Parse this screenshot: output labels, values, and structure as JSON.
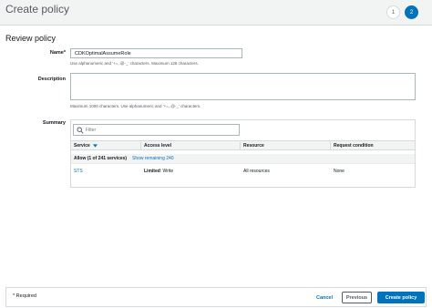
{
  "header": {
    "title": "Create policy",
    "steps": [
      "1",
      "2"
    ],
    "active_step": "2"
  },
  "section": {
    "title": "Review policy"
  },
  "name_field": {
    "label": "Name*",
    "value": "CDKOptimalAssumeRole",
    "help": "Use alphanumeric and '+=,.@-_' characters. Maximum 128 characters."
  },
  "description_field": {
    "label": "Description",
    "value": "",
    "help": "Maximum 1000 characters. Use alphanumeric and '+=,.@-_' characters."
  },
  "summary": {
    "label": "Summary",
    "filter_placeholder": "Filter",
    "columns": [
      "Service",
      "Access level",
      "Resource",
      "Request condition"
    ],
    "group": {
      "text": "Allow (1 of 241 services)",
      "link": "Show remaining 240"
    },
    "rows": [
      {
        "service": "STS",
        "access_level": "Limited",
        "access_detail": ": Write",
        "resource": "All resources",
        "condition": "None"
      }
    ]
  },
  "footer": {
    "required": "* Required",
    "cancel": "Cancel",
    "previous": "Previous",
    "create": "Create policy"
  },
  "colors": {
    "primary": "#0073bb",
    "link": "#0073bb",
    "header_bg": "#f2f3f3"
  }
}
